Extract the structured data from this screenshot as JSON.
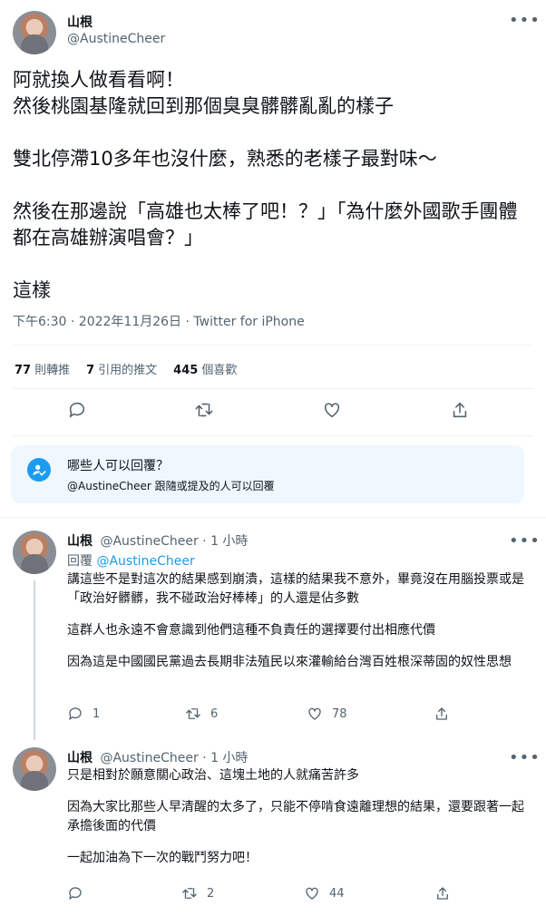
{
  "main_tweet": {
    "author_name": "山根",
    "handle": "@AustineCheer",
    "paragraphs": [
      "阿就換人做看看啊！\n然後桃園基隆就回到那個臭臭髒髒亂亂的樣子",
      "雙北停滯10多年也沒什麼，熟悉的老樣子最對味～",
      "然後在那邊說「高雄也太棒了吧！？」「為什麼外國歌手團體都在高雄辦演唱會？」",
      "這樣"
    ],
    "meta": "下午6:30 · 2022年11月26日 · Twitter for iPhone",
    "stats": {
      "retweets_count": "77",
      "retweets_label": "則轉推",
      "quotes_count": "7",
      "quotes_label": "引用的推文",
      "likes_count": "445",
      "likes_label": "個喜歡"
    }
  },
  "who_can_reply": {
    "title": "哪些人可以回覆？",
    "subtitle": "@AustineCheer 跟隨或提及的人可以回覆"
  },
  "replies": [
    {
      "author_name": "山根",
      "handle": "@AustineCheer",
      "time": "1 小時",
      "replying_label": "回覆",
      "replying_to": "@AustineCheer",
      "paragraphs": [
        "講這些不是對這次的結果感到崩潰，這樣的結果我不意外，畢竟沒在用腦投票或是「政治好髒髒，我不碰政治好棒棒」的人還是佔多數",
        "這群人也永遠不會意識到他們這種不負責任的選擇要付出相應代價",
        "因為這是中國國民黨過去長期非法殖民以來灌輸給台灣百姓根深蒂固的奴性思想"
      ],
      "reply_count": "1",
      "retweet_count": "6",
      "like_count": "78"
    },
    {
      "author_name": "山根",
      "handle": "@AustineCheer",
      "time": "1 小時",
      "paragraphs": [
        "只是相對於願意關心政治、這塊土地的人就痛苦許多",
        "因為大家比那些人早清醒的太多了，只能不停啃食遠離理想的結果，還要跟著一起承擔後面的代價",
        "一起加油為下一次的戰鬥努力吧！"
      ],
      "reply_count": "",
      "retweet_count": "2",
      "like_count": "44"
    }
  ],
  "icons": {
    "more": "more-horizontal-icon",
    "reply": "reply-bubble-icon",
    "retweet": "retweet-icon",
    "like": "heart-icon",
    "share": "share-upload-icon",
    "who_can_reply": "person-check-icon"
  },
  "colors": {
    "accent": "#1d9bf0",
    "text": "#0f1419",
    "secondary_text": "#536471",
    "info_box": "#eef8fe"
  }
}
